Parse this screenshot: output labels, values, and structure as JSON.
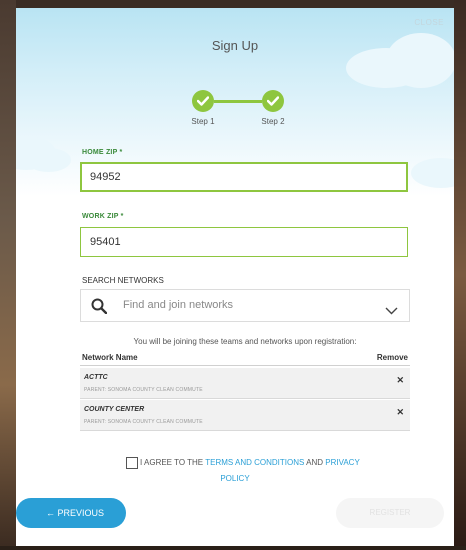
{
  "modal": {
    "close_label": "CLOSE",
    "title": "Sign Up"
  },
  "steps": [
    {
      "label": "Step 1",
      "completed": true
    },
    {
      "label": "Step 2",
      "completed": true
    }
  ],
  "home_zip": {
    "label": "HOME ZIP *",
    "value": "94952"
  },
  "work_zip": {
    "label": "WORK ZIP *",
    "value": "95401"
  },
  "search_networks": {
    "label": "SEARCH NETWORKS",
    "placeholder": "Find and join networks"
  },
  "networks": {
    "note": "You will be joining these teams and networks upon registration:",
    "col_name": "Network Name",
    "col_remove": "Remove",
    "rows": [
      {
        "name": "ACTTC",
        "parent": "PARENT: SONOMA COUNTY CLEAN COMMUTE",
        "remove": "✕"
      },
      {
        "name": "COUNTY CENTER",
        "parent": "PARENT: SONOMA COUNTY CLEAN COMMUTE",
        "remove": "✕"
      }
    ]
  },
  "agreement": {
    "prefix": "I AGREE TO THE ",
    "terms_link": "TERMS AND CONDITIONS",
    "and": " AND ",
    "privacy_link_1": "PRIVACY",
    "privacy_link_2": "POLICY",
    "checked": false
  },
  "buttons": {
    "previous": "← PREVIOUS",
    "register": "REGISTER"
  },
  "colors": {
    "accent_green": "#8ec63f",
    "accent_blue": "#2a9fd6",
    "header_sky": "#b9e4f3"
  }
}
